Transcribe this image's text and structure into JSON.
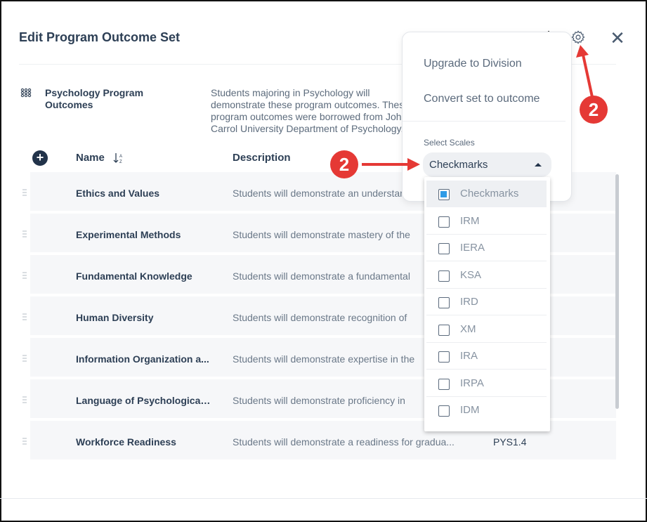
{
  "dialog": {
    "title": "Edit Program Outcome Set"
  },
  "outcome_set": {
    "name": "Psychology Program Outcomes",
    "description": "Students majoring in Psychology will demonstrate these program outcomes. These program outcomes were borrowed from John Carrol University Department of Psychology."
  },
  "table": {
    "headers": {
      "name": "Name",
      "description": "Description"
    },
    "rows": [
      {
        "name": "Ethics and Values",
        "description": "Students will demonstrate an understanding",
        "code": ""
      },
      {
        "name": "Experimental Methods",
        "description": "Students will demonstrate mastery of the",
        "code": ""
      },
      {
        "name": "Fundamental Knowledge",
        "description": "Students will demonstrate a fundamental",
        "code": ""
      },
      {
        "name": "Human Diversity",
        "description": "Students will demonstrate recognition of",
        "code": ""
      },
      {
        "name": "Information Organization a...",
        "description": "Students will demonstrate expertise in the",
        "code": ""
      },
      {
        "name": "Language of Psychological ...",
        "description": "Students will demonstrate proficiency in",
        "code": ""
      },
      {
        "name": "Workforce Readiness",
        "description": "Students will demonstrate a readiness for gradua...",
        "code": "PYS1.4"
      }
    ]
  },
  "settings_menu": {
    "items": [
      "Upgrade to Division",
      "Convert set to outcome"
    ],
    "scales_label": "Select Scales",
    "selected_scale": "Checkmarks",
    "scale_options": [
      {
        "label": "Checkmarks",
        "checked": true
      },
      {
        "label": "IRM",
        "checked": false
      },
      {
        "label": "IERA",
        "checked": false
      },
      {
        "label": "KSA",
        "checked": false
      },
      {
        "label": "IRD",
        "checked": false
      },
      {
        "label": "XM",
        "checked": false
      },
      {
        "label": "IRA",
        "checked": false
      },
      {
        "label": "IRPA",
        "checked": false
      },
      {
        "label": "IDM",
        "checked": false
      }
    ]
  },
  "annotations": {
    "callout_gear": "2",
    "callout_select": "2",
    "accent_color": "#e53935"
  }
}
